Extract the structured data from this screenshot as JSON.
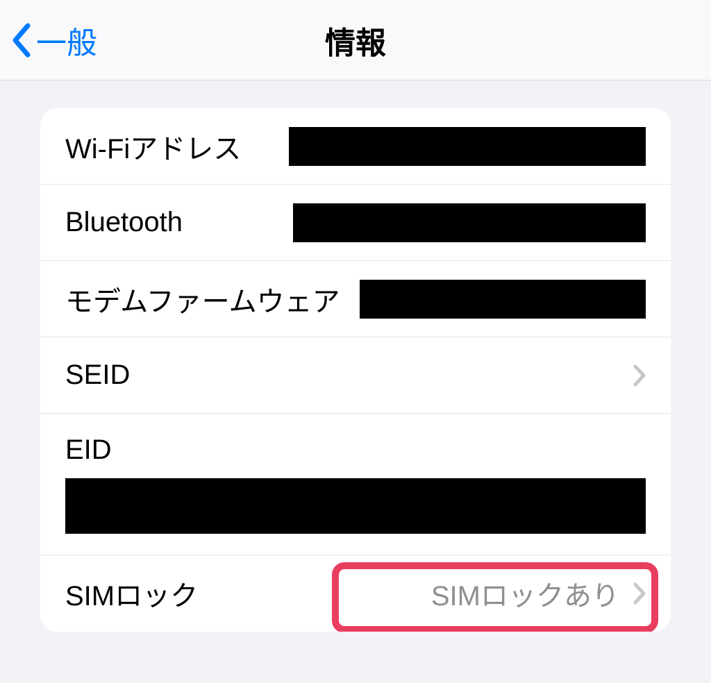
{
  "nav": {
    "back_label": "一般",
    "title": "情報"
  },
  "rows": {
    "wifi": {
      "label": "Wi-Fiアドレス"
    },
    "bluetooth": {
      "label": "Bluetooth"
    },
    "modem": {
      "label": "モデムファームウェア"
    },
    "seid": {
      "label": "SEID"
    },
    "eid": {
      "label": "EID"
    },
    "simlock": {
      "label": "SIMロック",
      "value": "SIMロックあり"
    }
  }
}
